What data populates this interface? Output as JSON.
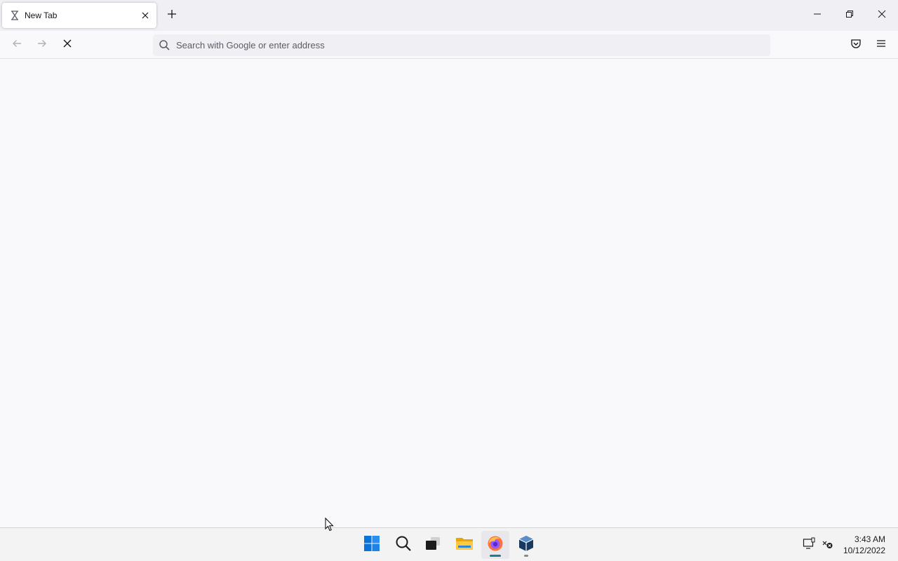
{
  "browser": {
    "tabs": [
      {
        "title": "New Tab",
        "loading": true
      }
    ],
    "new_tab_icon": "plus-icon",
    "window_controls": [
      "minimize-icon",
      "restore-icon",
      "close-icon"
    ],
    "nav": {
      "back_icon": "arrow-left-icon",
      "forward_icon": "arrow-right-icon",
      "stop_icon": "stop-x-icon"
    },
    "urlbar": {
      "placeholder": "Search with Google or enter address",
      "value": ""
    },
    "toolbar_right": [
      "pocket-icon",
      "hamburger-menu-icon"
    ]
  },
  "taskbar": {
    "apps": [
      {
        "name": "start",
        "icon": "windows-logo-icon"
      },
      {
        "name": "search",
        "icon": "search-icon"
      },
      {
        "name": "task-view",
        "icon": "task-view-icon"
      },
      {
        "name": "file-explorer",
        "icon": "folder-icon"
      },
      {
        "name": "firefox",
        "icon": "firefox-icon",
        "active": true
      },
      {
        "name": "virtualbox",
        "icon": "virtualbox-icon",
        "running": true
      }
    ],
    "tray": {
      "icons": [
        "display-icon",
        "network-disconnected-icon"
      ],
      "time": "3:43 AM",
      "date": "10/12/2022"
    }
  },
  "colors": {
    "accent": "#0078d4",
    "firefox_indicator": "#1a7f8c",
    "content_bg": "#f9f9fb"
  }
}
